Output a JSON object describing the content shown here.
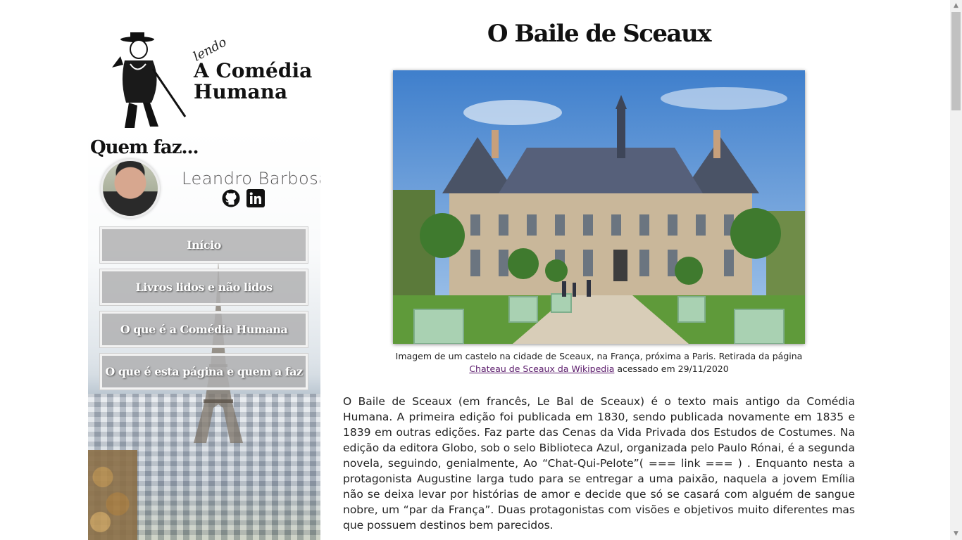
{
  "sidebar": {
    "logo": {
      "small_text": "lendo",
      "title_line1": "A Comédia",
      "title_line2": "Humana"
    },
    "who_heading": "Quem faz...",
    "author_name": "Leandro Barbosa",
    "social": [
      "github-icon",
      "linkedin-icon"
    ],
    "nav": [
      {
        "label": "Início"
      },
      {
        "label": "Livros lidos e não lidos"
      },
      {
        "label": "O que é a Comédia Humana"
      },
      {
        "label": "O que é esta página e quem a faz"
      }
    ]
  },
  "main": {
    "title": "O Baile de Sceaux",
    "caption": {
      "text_before": "Imagem de um castelo na cidade de Sceaux, na França, próxima a Paris. Retirada da página",
      "link_text": "Chateau de Sceaux da Wikipedia",
      "text_after": " acessado em 29/11/2020"
    },
    "body": "O Baile de Sceaux (em francês, Le Bal de Sceaux) é o texto mais antigo da Comédia Humana. A primeira edição foi publicada em 1830, sendo publicada novamente em 1835 e 1839 em outras edições. Faz parte das Cenas da Vida Privada dos Estudos de Costumes. Na edição da editora Globo, sob o selo Biblioteca Azul, organizada pelo Paulo Rónai, é a segunda novela, seguindo, genialmente, Ao “Chat-Qui-Pelote”( === link === ) . Enquanto nesta a protagonista Augustine larga tudo para se entregar a uma paixão, naquela a jovem Emília não se deixa levar por histórias de amor e decide que só se casará com alguém de sangue nobre, um “par da França”. Duas protagonistas com visões e objetivos muito diferentes mas que possuem destinos bem parecidos."
  },
  "colors": {
    "nav_button_bg": "#b0b0b2",
    "link": "#5a1a6b"
  }
}
